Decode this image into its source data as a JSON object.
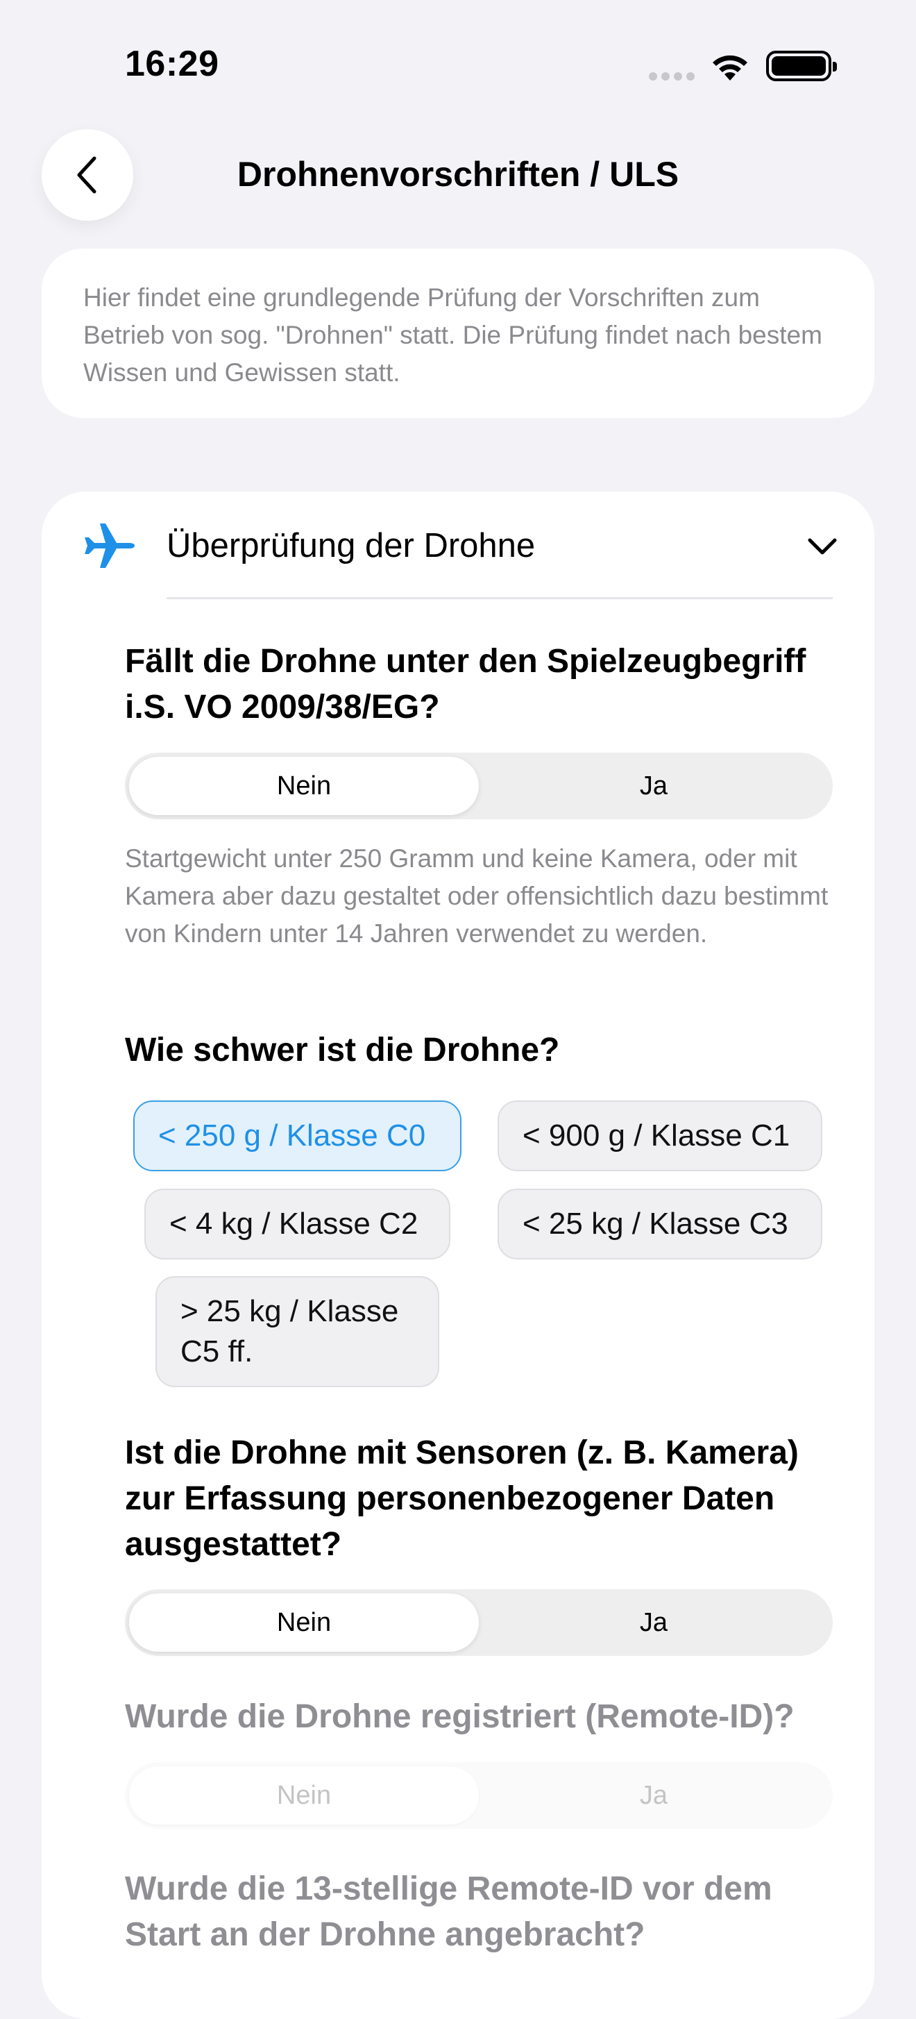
{
  "status_bar": {
    "time": "16:29"
  },
  "nav": {
    "title": "Drohnenvorschriften / ULS"
  },
  "info": {
    "text": "Hier findet eine grundlegende Prüfung der Vorschriften zum Betrieb von sog. \"Drohnen\" statt. Die Prüfung findet nach bestem Wissen und Gewissen statt."
  },
  "section": {
    "title": "Überprüfung der Drohne",
    "icon": "airplane-icon",
    "accent": "#1e90e8"
  },
  "q1": {
    "question": "Fällt die Drohne unter den Spielzeugbegriff i.S. VO 2009/38/EG?",
    "options": [
      "Nein",
      "Ja"
    ],
    "selected": "Nein",
    "hint": "Startgewicht unter 250 Gramm und keine Kamera, oder mit Kamera aber dazu gestaltet oder offensichtlich dazu bestimmt von Kindern unter 14 Jahren verwendet zu werden."
  },
  "q2": {
    "question": "Wie schwer ist die Drohne?",
    "options": [
      "< 250 g / Klasse C0",
      "< 900 g / Klasse C1",
      "< 4 kg / Klasse C2",
      "< 25 kg / Klasse C3",
      "> 25 kg / Klasse C5 ff."
    ],
    "selected": "< 250 g / Klasse C0"
  },
  "q3": {
    "question": "Ist die Drohne mit Sensoren (z. B. Kamera) zur Erfassung personenbezogener Daten ausgestattet?",
    "options": [
      "Nein",
      "Ja"
    ],
    "selected": "Nein"
  },
  "q4": {
    "question": "Wurde die Drohne registriert (Remote-ID)?",
    "options": [
      "Nein",
      "Ja"
    ],
    "selected": "Nein",
    "disabled": true
  },
  "q5": {
    "question": "Wurde die 13-stellige Remote-ID vor dem Start an der Drohne angebracht?",
    "disabled": true
  }
}
